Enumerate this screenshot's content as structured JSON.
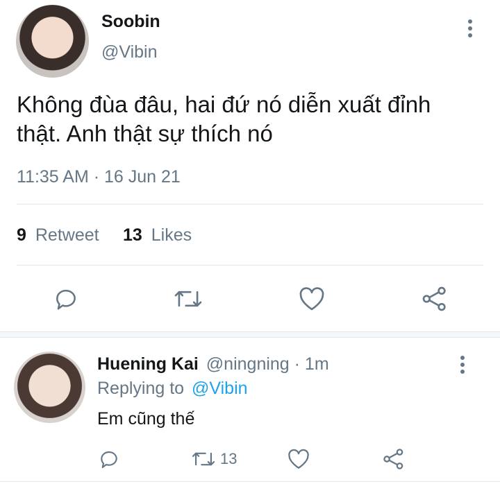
{
  "main_tweet": {
    "display_name": "Soobin",
    "handle": "@Vibin",
    "text_line1": "Không đùa đâu, hai đứ nó diễn xuất đỉnh",
    "text_line2": "thật. Anh thật sự thích nó",
    "timestamp": "11:35 AM · 16 Jun 21",
    "retweet_count": "9",
    "retweet_label": "Retweet",
    "likes_count": "13",
    "likes_label": "Likes"
  },
  "reply": {
    "display_name": "Huening Kai",
    "handle_time": "@ningning · 1m",
    "replying_prefix": "Replying to",
    "replying_handle": "@Vibin",
    "text": "Em cũng thế",
    "retweet_count": "13"
  },
  "icons": {
    "more": "more-vertical-icon",
    "reply": "comment-icon",
    "retweet": "retweet-icon",
    "like": "heart-icon",
    "share": "share-icon"
  },
  "colors": {
    "text": "#14171a",
    "muted": "#657786",
    "accent": "#1da1f2",
    "divider": "#e1e8ed"
  }
}
